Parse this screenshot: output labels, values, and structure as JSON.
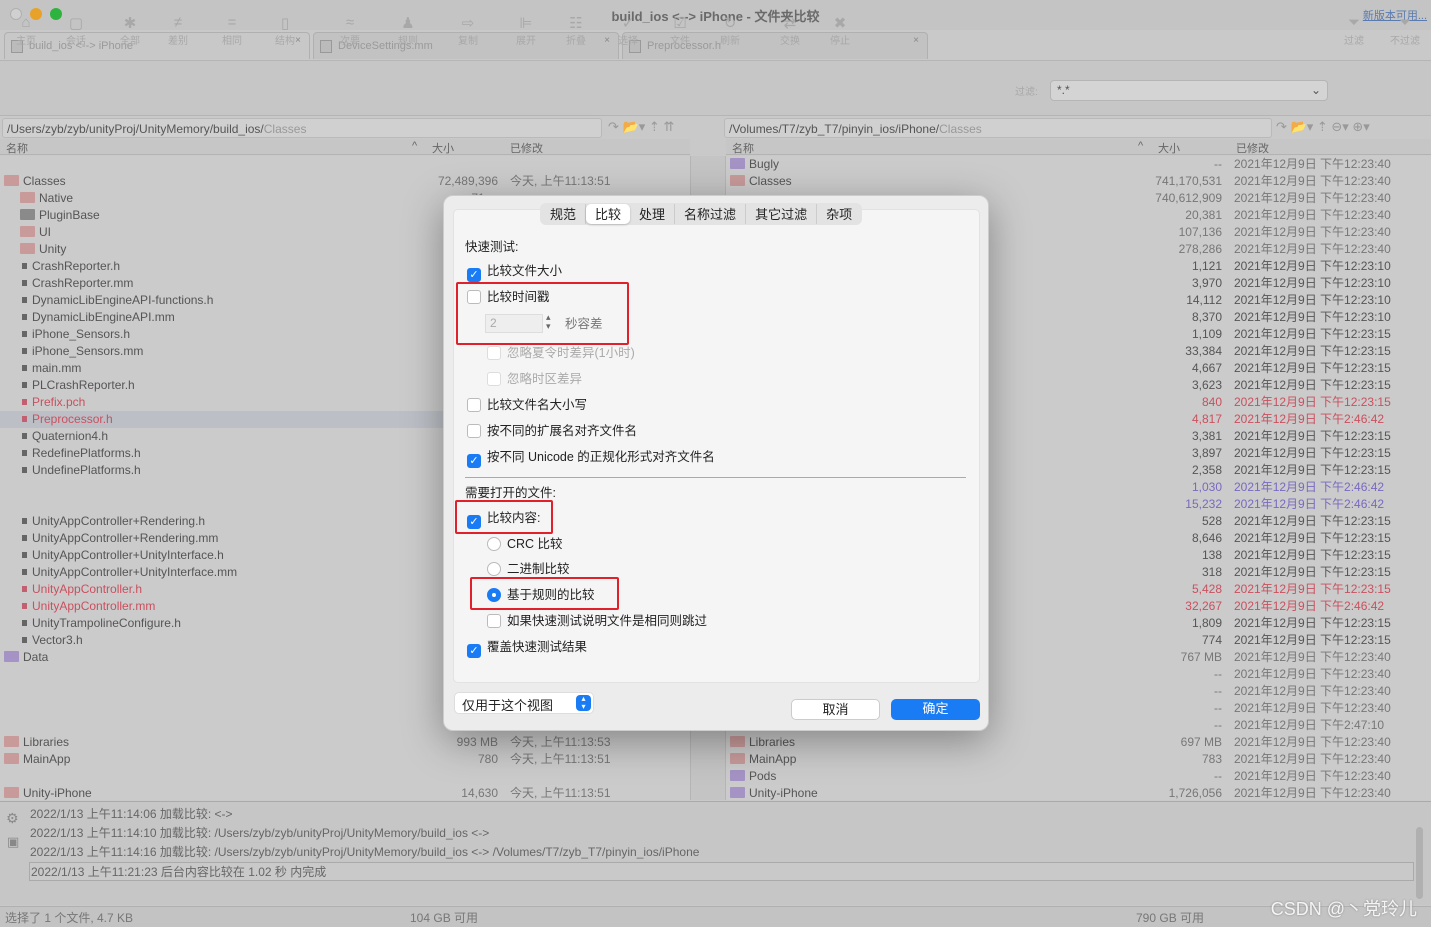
{
  "window": {
    "title": "build_ios <--> iPhone - 文件夹比较",
    "update_link": "新版本可用..."
  },
  "tabs": [
    {
      "label": "build_ios <--> iPhone"
    },
    {
      "label": "DeviceSettings.mm"
    },
    {
      "label": "Preprocessor.h"
    }
  ],
  "toolbar": {
    "buttons": [
      {
        "label": "主页",
        "icon": "home-icon",
        "glyph": "⌂"
      },
      {
        "label": "会话",
        "icon": "briefcase-icon",
        "glyph": "▢"
      },
      {
        "label": "全部",
        "icon": "asterisk-icon",
        "glyph": "✱"
      },
      {
        "label": "差别",
        "icon": "not-equal-icon",
        "glyph": "≠"
      },
      {
        "label": "相同",
        "icon": "equal-icon",
        "glyph": "="
      },
      {
        "label": "结构",
        "icon": "structure-icon",
        "glyph": "▯"
      },
      {
        "label": "次要",
        "icon": "approx-icon",
        "glyph": "≈"
      },
      {
        "label": "规则",
        "icon": "rules-icon",
        "glyph": "♟"
      },
      {
        "label": "复制",
        "icon": "copy-arrow-icon",
        "glyph": "⇨"
      },
      {
        "label": "展开",
        "icon": "expand-icon",
        "glyph": "⊫"
      },
      {
        "label": "折叠",
        "icon": "collapse-icon",
        "glyph": "☷"
      },
      {
        "label": "选择",
        "icon": "checkmark-icon",
        "glyph": "✓"
      },
      {
        "label": "文件",
        "icon": "file-check-icon",
        "glyph": "☑"
      },
      {
        "label": "刷新",
        "icon": "refresh-icon",
        "glyph": "↻"
      },
      {
        "label": "交换",
        "icon": "swap-icon",
        "glyph": "⇄"
      },
      {
        "label": "停止",
        "icon": "stop-icon",
        "glyph": "✖"
      }
    ],
    "filter_label": "过滤:",
    "filter_value": "*.*",
    "filter_btn": "过滤",
    "unfilter_btn": "不过滤"
  },
  "left": {
    "path_main": "/Users/zyb/zyb/unityProj/UnityMemory/build_ios/",
    "path_dim": "Classes",
    "col_name": "名称",
    "col_size": "大小",
    "col_modified": "已修改",
    "rows": [
      {
        "name": "",
        "type": "blank"
      },
      {
        "name": "Classes",
        "type": "folder",
        "size": "72,489,396",
        "date": "今天, 上午11:13:51"
      },
      {
        "name": "Native",
        "type": "folder",
        "indent": 1,
        "size": "71,...",
        "date": ""
      },
      {
        "name": "PluginBase",
        "type": "folder-gray",
        "indent": 1
      },
      {
        "name": "UI",
        "type": "folder",
        "indent": 1
      },
      {
        "name": "Unity",
        "type": "folder",
        "indent": 1
      },
      {
        "name": "CrashReporter.h",
        "type": "file"
      },
      {
        "name": "CrashReporter.mm",
        "type": "file"
      },
      {
        "name": "DynamicLibEngineAPI-functions.h",
        "type": "file"
      },
      {
        "name": "DynamicLibEngineAPI.mm",
        "type": "file"
      },
      {
        "name": "iPhone_Sensors.h",
        "type": "file"
      },
      {
        "name": "iPhone_Sensors.mm",
        "type": "file"
      },
      {
        "name": "main.mm",
        "type": "file"
      },
      {
        "name": "PLCrashReporter.h",
        "type": "file"
      },
      {
        "name": "Prefix.pch",
        "type": "file",
        "status": "diff"
      },
      {
        "name": "Preprocessor.h",
        "type": "file",
        "status": "diff",
        "selected": true
      },
      {
        "name": "Quaternion4.h",
        "type": "file"
      },
      {
        "name": "RedefinePlatforms.h",
        "type": "file"
      },
      {
        "name": "UndefinePlatforms.h",
        "type": "file"
      },
      {
        "name": "",
        "type": "blank"
      },
      {
        "name": "",
        "type": "blank"
      },
      {
        "name": "UnityAppController+Rendering.h",
        "type": "file"
      },
      {
        "name": "UnityAppController+Rendering.mm",
        "type": "file"
      },
      {
        "name": "UnityAppController+UnityInterface.h",
        "type": "file"
      },
      {
        "name": "UnityAppController+UnityInterface.mm",
        "type": "file"
      },
      {
        "name": "UnityAppController.h",
        "type": "file",
        "status": "diff"
      },
      {
        "name": "UnityAppController.mm",
        "type": "file",
        "status": "diff"
      },
      {
        "name": "UnityTrampolineConfigure.h",
        "type": "file"
      },
      {
        "name": "Vector3.h",
        "type": "file"
      },
      {
        "name": "Data",
        "type": "folder-purple"
      },
      {
        "name": "",
        "type": "blank"
      },
      {
        "name": "",
        "type": "blank"
      },
      {
        "name": "",
        "type": "blank"
      },
      {
        "name": "",
        "type": "blank"
      },
      {
        "name": "Libraries",
        "type": "folder",
        "size": "993 MB",
        "date": "今天, 上午11:13:53"
      },
      {
        "name": "MainApp",
        "type": "folder",
        "size": "780",
        "date": "今天, 上午11:13:51"
      },
      {
        "name": "",
        "type": "blank"
      },
      {
        "name": "Unity-iPhone",
        "type": "folder",
        "size": "14,630",
        "date": "今天, 上午11:13:51"
      }
    ],
    "free_space": "104 GB 可用"
  },
  "right": {
    "path_main": "/Volumes/T7/zyb_T7/pinyin_ios/iPhone/",
    "path_dim": "Classes",
    "col_name": "名称",
    "col_size": "大小",
    "col_modified": "已修改",
    "rows": [
      {
        "name": "Bugly",
        "type": "folder-purple",
        "size": "--",
        "date": "2021年12月9日 下午12:23:40",
        "status": "dim"
      },
      {
        "name": "Classes",
        "type": "folder",
        "size": "741,170,531",
        "date": "2021年12月9日 下午12:23:40",
        "status": "dim"
      },
      {
        "name": "",
        "size": "740,612,909",
        "date": "2021年12月9日 下午12:23:40",
        "status": "dim"
      },
      {
        "name": "",
        "size": "20,381",
        "date": "2021年12月9日 下午12:23:40",
        "status": "dim"
      },
      {
        "name": "",
        "size": "107,136",
        "date": "2021年12月9日 下午12:23:40",
        "status": "dim"
      },
      {
        "name": "",
        "size": "278,286",
        "date": "2021年12月9日 下午12:23:40",
        "status": "dim"
      },
      {
        "name": "",
        "size": "1,121",
        "date": "2021年12月9日 下午12:23:10"
      },
      {
        "name": "",
        "size": "3,970",
        "date": "2021年12月9日 下午12:23:10"
      },
      {
        "name": "",
        "size": "14,112",
        "date": "2021年12月9日 下午12:23:10"
      },
      {
        "name": "",
        "size": "8,370",
        "date": "2021年12月9日 下午12:23:10"
      },
      {
        "name": "",
        "size": "1,109",
        "date": "2021年12月9日 下午12:23:15"
      },
      {
        "name": "",
        "size": "33,384",
        "date": "2021年12月9日 下午12:23:15"
      },
      {
        "name": "",
        "size": "4,667",
        "date": "2021年12月9日 下午12:23:15"
      },
      {
        "name": "",
        "size": "3,623",
        "date": "2021年12月9日 下午12:23:15"
      },
      {
        "name": "",
        "size": "840",
        "date": "2021年12月9日 下午12:23:15",
        "status": "diff"
      },
      {
        "name": "",
        "size": "4,817",
        "date": "2021年12月9日 下午2:46:42",
        "status": "diff"
      },
      {
        "name": "",
        "size": "3,381",
        "date": "2021年12月9日 下午12:23:15"
      },
      {
        "name": "",
        "size": "3,897",
        "date": "2021年12月9日 下午12:23:15"
      },
      {
        "name": "",
        "size": "2,358",
        "date": "2021年12月9日 下午12:23:15"
      },
      {
        "name": "",
        "size": "1,030",
        "date": "2021年12月9日 下午2:46:42",
        "status": "orphan"
      },
      {
        "name": "",
        "size": "15,232",
        "date": "2021年12月9日 下午2:46:42",
        "status": "orphan"
      },
      {
        "name": "",
        "size": "528",
        "date": "2021年12月9日 下午12:23:15"
      },
      {
        "name": "",
        "size": "8,646",
        "date": "2021年12月9日 下午12:23:15"
      },
      {
        "name": "",
        "size": "138",
        "date": "2021年12月9日 下午12:23:15"
      },
      {
        "name": "",
        "size": "318",
        "date": "2021年12月9日 下午12:23:15"
      },
      {
        "name": "",
        "size": "5,428",
        "date": "2021年12月9日 下午12:23:15",
        "status": "diff"
      },
      {
        "name": "",
        "size": "32,267",
        "date": "2021年12月9日 下午2:46:42",
        "status": "diff"
      },
      {
        "name": "",
        "size": "1,809",
        "date": "2021年12月9日 下午12:23:15"
      },
      {
        "name": "",
        "size": "774",
        "date": "2021年12月9日 下午12:23:15"
      },
      {
        "name": "",
        "size": "767 MB",
        "date": "2021年12月9日 下午12:23:40",
        "status": "dim"
      },
      {
        "name": "",
        "size": "--",
        "date": "2021年12月9日 下午12:23:40",
        "status": "dim"
      },
      {
        "name": "",
        "size": "--",
        "date": "2021年12月9日 下午12:23:40",
        "status": "dim"
      },
      {
        "name": "",
        "size": "--",
        "date": "2021年12月9日 下午12:23:40",
        "status": "dim"
      },
      {
        "name": "",
        "size": "--",
        "date": "2021年12月9日 下午2:47:10",
        "status": "dim"
      },
      {
        "name": "Libraries",
        "type": "folder",
        "size": "697 MB",
        "date": "2021年12月9日 下午12:23:40",
        "status": "dim"
      },
      {
        "name": "MainApp",
        "type": "folder",
        "size": "783",
        "date": "2021年12月9日 下午12:23:40",
        "status": "dim"
      },
      {
        "name": "Pods",
        "type": "folder-purple",
        "size": "--",
        "date": "2021年12月9日 下午12:23:40",
        "status": "dim"
      },
      {
        "name": "Unity-iPhone",
        "type": "folder-purple",
        "size": "1,726,056",
        "date": "2021年12月9日 下午12:23:40",
        "status": "dim"
      }
    ],
    "free_space": "790 GB 可用"
  },
  "colors": {
    "diff": "#c9505e",
    "orphan": "#7a68c0",
    "accent": "#1a7cf5",
    "highlight": "#e0202a"
  },
  "log": [
    "2022/1/13 上午11:14:06  加载比较:   <->",
    "2022/1/13 上午11:14:10  加载比较:   /Users/zyb/zyb/unityProj/UnityMemory/build_ios <->",
    "2022/1/13 上午11:14:16  加载比较:   /Users/zyb/zyb/unityProj/UnityMemory/build_ios <-> /Volumes/T7/zyb_T7/pinyin_ios/iPhone",
    "2022/1/13 上午11:21:23  后台内容比较在 1.02 秒 内完成"
  ],
  "status": {
    "selection": "选择了 1 个文件, 4.7 KB"
  },
  "watermark": "CSDN @丶党玲儿",
  "dialog": {
    "tabs": [
      "规范",
      "比较",
      "处理",
      "名称过滤",
      "其它过滤",
      "杂项"
    ],
    "active_tab": "比较",
    "quick_test_heading": "快速测试:",
    "compare_size": {
      "label": "比较文件大小",
      "checked": true
    },
    "compare_timestamp": {
      "label": "比较时间戳",
      "checked": false
    },
    "tolerance_value": "2",
    "tolerance_unit": "秒容差",
    "ignore_dst": {
      "label": "忽略夏令时差异(1小时)",
      "checked": false
    },
    "ignore_tz": {
      "label": "忽略时区差异",
      "checked": false
    },
    "compare_case": {
      "label": "比较文件名大小写",
      "checked": false
    },
    "align_ext": {
      "label": "按不同的扩展名对齐文件名",
      "checked": false
    },
    "align_unicode": {
      "label": "按不同 Unicode 的正规化形式对齐文件名",
      "checked": true
    },
    "open_files_heading": "需要打开的文件:",
    "compare_content": {
      "label": "比较内容:",
      "checked": true
    },
    "crc": {
      "label": "CRC 比较",
      "selected": false
    },
    "binary": {
      "label": "二进制比较",
      "selected": false
    },
    "rules": {
      "label": "基于规则的比较",
      "selected": true
    },
    "skip_if_same": {
      "label": "如果快速测试说明文件是相同则跳过",
      "checked": false
    },
    "override": {
      "label": "覆盖快速测试结果",
      "checked": true
    },
    "scope_select": "仅用于这个视图",
    "cancel": "取消",
    "ok": "确定"
  }
}
